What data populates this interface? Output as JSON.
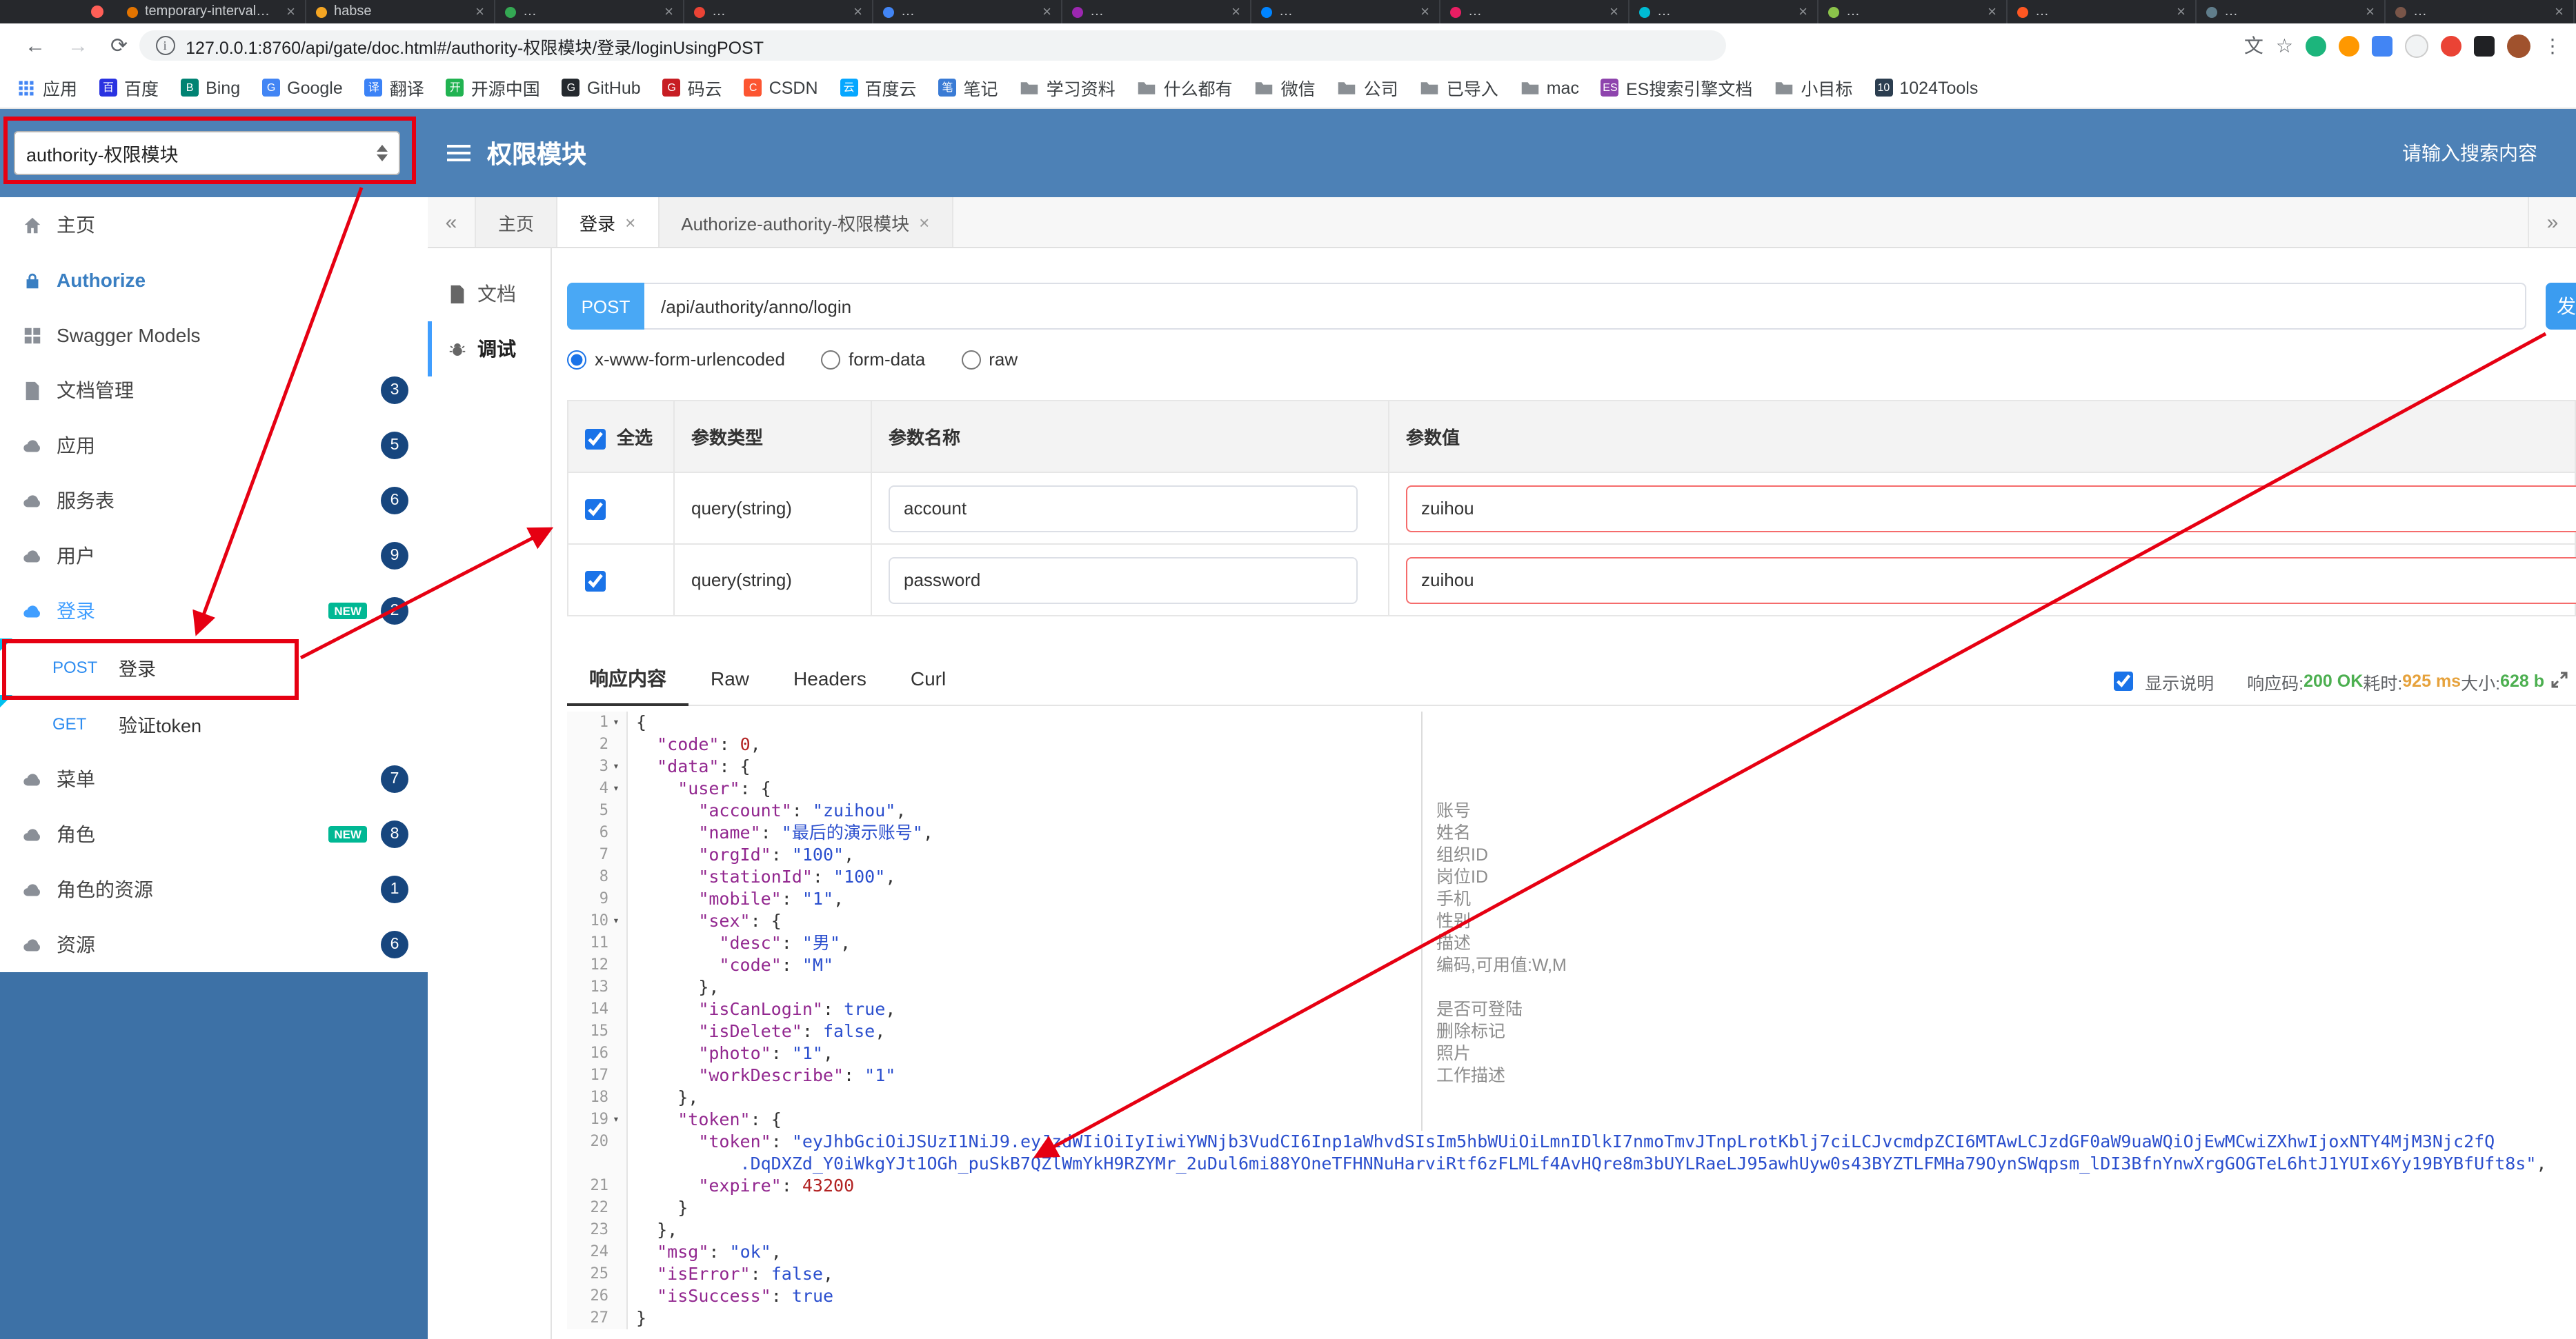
{
  "ui": {
    "close_glyph": "×",
    "fold_glyph": "▾",
    "info_glyph": "i"
  },
  "browser": {
    "tabs": [
      {
        "label": "temporary-interval…",
        "color": "#e37400"
      },
      {
        "label": "habse",
        "color": "#f5a623"
      },
      {
        "label": "…",
        "color": "#34a853"
      },
      {
        "label": "…",
        "color": "#ea4335"
      },
      {
        "label": "…",
        "color": "#4285f4"
      },
      {
        "label": "…",
        "color": "#9c27b0"
      },
      {
        "label": "…",
        "color": "#0084ff"
      },
      {
        "label": "…",
        "color": "#e91e63"
      },
      {
        "label": "…",
        "color": "#00bcd4"
      },
      {
        "label": "…",
        "color": "#8bc34a"
      },
      {
        "label": "…",
        "color": "#ff5722"
      },
      {
        "label": "…",
        "color": "#607d8b"
      },
      {
        "label": "…",
        "color": "#795548"
      },
      {
        "label": "…",
        "color": "#3f51b5"
      }
    ],
    "toolbar": {
      "url": "127.0.0.1:8760/api/gate/doc.html#/authority-权限模块/登录/loginUsingPOST",
      "icons": [
        "back",
        "forward",
        "reload",
        "info",
        "translate",
        "star",
        "ext-green",
        "ext-orange",
        "ext-blue",
        "ext-light",
        "ext-red",
        "ext-dark",
        "avatar",
        "menu"
      ]
    },
    "bookmarks": [
      {
        "label": "应用",
        "icon": "apps"
      },
      {
        "label": "百度",
        "icon": "letter",
        "letter": "百",
        "color": "#2932e1"
      },
      {
        "label": "Bing",
        "icon": "letter",
        "letter": "B",
        "color": "#008373"
      },
      {
        "label": "Google",
        "icon": "letter",
        "letter": "G",
        "color": "#4285f4"
      },
      {
        "label": "翻译",
        "icon": "letter",
        "letter": "译",
        "color": "#3b82f6"
      },
      {
        "label": "开源中国",
        "icon": "letter",
        "letter": "开",
        "color": "#21b351"
      },
      {
        "label": "GitHub",
        "icon": "letter",
        "letter": "G",
        "color": "#24292e"
      },
      {
        "label": "码云",
        "icon": "letter",
        "letter": "G",
        "color": "#c71d23"
      },
      {
        "label": "CSDN",
        "icon": "letter",
        "letter": "C",
        "color": "#fc5531"
      },
      {
        "label": "百度云",
        "icon": "letter",
        "letter": "云",
        "color": "#06a7ff"
      },
      {
        "label": "笔记",
        "icon": "letter",
        "letter": "笔",
        "color": "#3a7bd5"
      },
      {
        "label": "学习资料",
        "icon": "folder"
      },
      {
        "label": "什么都有",
        "icon": "folder"
      },
      {
        "label": "微信",
        "icon": "folder"
      },
      {
        "label": "公司",
        "icon": "folder"
      },
      {
        "label": "已导入",
        "icon": "folder"
      },
      {
        "label": "mac",
        "icon": "folder"
      },
      {
        "label": "ES搜索引擎文档",
        "icon": "letter",
        "letter": "ES",
        "color": "#8e44ad"
      },
      {
        "label": "小目标",
        "icon": "folder"
      },
      {
        "label": "1024Tools",
        "icon": "letter",
        "letter": "10",
        "color": "#2c3e50"
      }
    ]
  },
  "header": {
    "module_select": "authority-权限模块",
    "title": "权限模块",
    "search": "请输入搜索内容"
  },
  "sidebar": {
    "new_label": "NEW",
    "items": [
      {
        "id": "home",
        "icon": "home",
        "label": "主页"
      },
      {
        "id": "authorize",
        "icon": "lock",
        "label": "Authorize",
        "authorize": true
      },
      {
        "id": "models",
        "icon": "models",
        "label": "Swagger Models"
      },
      {
        "id": "docs",
        "icon": "doc",
        "label": "文档管理",
        "badge": "3"
      },
      {
        "id": "app",
        "icon": "cloud",
        "label": "应用",
        "badge": "5"
      },
      {
        "id": "service",
        "icon": "cloud",
        "label": "服务表",
        "badge": "6"
      },
      {
        "id": "user",
        "icon": "cloud",
        "label": "用户",
        "badge": "9"
      },
      {
        "id": "login",
        "icon": "cloud",
        "label": "登录",
        "badge": "2",
        "isNew": true,
        "active": true,
        "children": [
          {
            "method": "POST",
            "label": "登录",
            "highlight": true
          },
          {
            "method": "GET",
            "label": "验证token"
          }
        ]
      },
      {
        "id": "menu",
        "icon": "cloud",
        "label": "菜单",
        "badge": "7"
      },
      {
        "id": "role",
        "icon": "cloud",
        "label": "角色",
        "badge": "8",
        "isNew": true
      },
      {
        "id": "role-res",
        "icon": "cloud",
        "label": "角色的资源",
        "badge": "1"
      },
      {
        "id": "res",
        "icon": "cloud",
        "label": "资源",
        "badge": "6"
      }
    ]
  },
  "content_tabs": {
    "back": "«",
    "forward": "»",
    "items": [
      {
        "label": "主页",
        "closable": false
      },
      {
        "label": "登录",
        "closable": true,
        "active": true
      },
      {
        "label": "Authorize-authority-权限模块",
        "closable": true
      }
    ]
  },
  "doc_nav": {
    "items": [
      {
        "label": "文档",
        "icon": "doc"
      },
      {
        "label": "调试",
        "icon": "debug",
        "active": true
      }
    ]
  },
  "request": {
    "method": "POST",
    "path": "/api/authority/anno/login",
    "send": "发送",
    "content_types": [
      {
        "label": "x-www-form-urlencoded",
        "selected": true
      },
      {
        "label": "form-data",
        "selected": false
      },
      {
        "label": "raw",
        "selected": false
      }
    ]
  },
  "params": {
    "select_all": "全选",
    "headers": [
      "参数类型",
      "参数名称",
      "参数值"
    ],
    "rows": [
      {
        "checked": true,
        "type": "query(string)",
        "name": "account",
        "value": "zuihou"
      },
      {
        "checked": true,
        "type": "query(string)",
        "name": "password",
        "value": "zuihou"
      }
    ]
  },
  "response": {
    "tabs": [
      {
        "label": "响应内容",
        "active": true
      },
      {
        "label": "Raw",
        "active": false
      },
      {
        "label": "Headers",
        "active": false
      },
      {
        "label": "Curl",
        "active": false
      }
    ],
    "show_desc": "显示说明",
    "meta": [
      {
        "label": "响应码:",
        "value": "200 OK",
        "color": "#4caf50"
      },
      {
        "label": "耗时:",
        "value": "925 ms",
        "color": "#e6a23c"
      },
      {
        "label": "大小:",
        "value": "628 b",
        "color": "#4caf50"
      }
    ]
  },
  "code": {
    "lines": [
      {
        "n": 1,
        "indent": 0,
        "fold": true,
        "t": [
          [
            "p",
            "{"
          ]
        ]
      },
      {
        "n": 2,
        "indent": 1,
        "t": [
          [
            "k",
            "\"code\""
          ],
          [
            "p",
            ": "
          ],
          [
            "n",
            "0"
          ],
          [
            "p",
            ","
          ]
        ]
      },
      {
        "n": 3,
        "indent": 1,
        "fold": true,
        "t": [
          [
            "k",
            "\"data\""
          ],
          [
            "p",
            ": {"
          ]
        ]
      },
      {
        "n": 4,
        "indent": 2,
        "fold": true,
        "t": [
          [
            "k",
            "\"user\""
          ],
          [
            "p",
            ": {"
          ]
        ]
      },
      {
        "n": 5,
        "indent": 3,
        "desc": "账号",
        "t": [
          [
            "k",
            "\"account\""
          ],
          [
            "p",
            ": "
          ],
          [
            "s",
            "\"zuihou\""
          ],
          [
            "p",
            ","
          ]
        ]
      },
      {
        "n": 6,
        "indent": 3,
        "desc": "姓名",
        "t": [
          [
            "k",
            "\"name\""
          ],
          [
            "p",
            ": "
          ],
          [
            "s",
            "\"最后的演示账号\""
          ],
          [
            "p",
            ","
          ]
        ]
      },
      {
        "n": 7,
        "indent": 3,
        "desc": "组织ID",
        "t": [
          [
            "k",
            "\"orgId\""
          ],
          [
            "p",
            ": "
          ],
          [
            "s",
            "\"100\""
          ],
          [
            "p",
            ","
          ]
        ]
      },
      {
        "n": 8,
        "indent": 3,
        "desc": "岗位ID",
        "t": [
          [
            "k",
            "\"stationId\""
          ],
          [
            "p",
            ": "
          ],
          [
            "s",
            "\"100\""
          ],
          [
            "p",
            ","
          ]
        ]
      },
      {
        "n": 9,
        "indent": 3,
        "desc": "手机",
        "t": [
          [
            "k",
            "\"mobile\""
          ],
          [
            "p",
            ": "
          ],
          [
            "s",
            "\"1\""
          ],
          [
            "p",
            ","
          ]
        ]
      },
      {
        "n": 10,
        "indent": 3,
        "fold": true,
        "desc": "性别",
        "t": [
          [
            "k",
            "\"sex\""
          ],
          [
            "p",
            ": {"
          ]
        ]
      },
      {
        "n": 11,
        "indent": 4,
        "desc": "描述",
        "t": [
          [
            "k",
            "\"desc\""
          ],
          [
            "p",
            ": "
          ],
          [
            "s",
            "\"男\""
          ],
          [
            "p",
            ","
          ]
        ]
      },
      {
        "n": 12,
        "indent": 4,
        "desc": "编码,可用值:W,M",
        "t": [
          [
            "k",
            "\"code\""
          ],
          [
            "p",
            ": "
          ],
          [
            "s",
            "\"M\""
          ]
        ]
      },
      {
        "n": 13,
        "indent": 3,
        "t": [
          [
            "p",
            "},"
          ]
        ]
      },
      {
        "n": 14,
        "indent": 3,
        "desc": "是否可登陆",
        "t": [
          [
            "k",
            "\"isCanLogin\""
          ],
          [
            "p",
            ": "
          ],
          [
            "b",
            "true"
          ],
          [
            "p",
            ","
          ]
        ]
      },
      {
        "n": 15,
        "indent": 3,
        "desc": "删除标记",
        "t": [
          [
            "k",
            "\"isDelete\""
          ],
          [
            "p",
            ": "
          ],
          [
            "b",
            "false"
          ],
          [
            "p",
            ","
          ]
        ]
      },
      {
        "n": 16,
        "indent": 3,
        "desc": "照片",
        "t": [
          [
            "k",
            "\"photo\""
          ],
          [
            "p",
            ": "
          ],
          [
            "s",
            "\"1\""
          ],
          [
            "p",
            ","
          ]
        ]
      },
      {
        "n": 17,
        "indent": 3,
        "desc": "工作描述",
        "t": [
          [
            "k",
            "\"workDescribe\""
          ],
          [
            "p",
            ": "
          ],
          [
            "s",
            "\"1\""
          ]
        ]
      },
      {
        "n": 18,
        "indent": 2,
        "t": [
          [
            "p",
            "},"
          ]
        ]
      },
      {
        "n": 19,
        "indent": 2,
        "fold": true,
        "t": [
          [
            "k",
            "\"token\""
          ],
          [
            "p",
            ": {"
          ]
        ]
      },
      {
        "n": 20,
        "indent": 3,
        "t": [
          [
            "k",
            "\"token\""
          ],
          [
            "p",
            ": "
          ],
          [
            "s",
            "\"eyJhbGciOiJSUzI1NiJ9.eyJzdWIiOiIyIiwiYWNjb3VudCI6Inp1aWhvdSIsIm5hbWUiOiLmnIDlkI7nmoTmvJTnpLrotKblj7ciLCJvcmdpZCI6MTAwLCJzdGF0aW9uaWQiOjEwMCwiZXhwIjoxNTY4MjM3Njc2fQ"
          ],
          [
            "br",
            "          "
          ],
          [
            "s",
            ".DqDXZd_Y0iWkgYJt1OGh_puSkB7QZlWmYkH9RZYMr_2uDul6mi88YOneTFHNNuHarviRtf6zFLMLf4AvHQre8m3bUYLRaeLJ95awhUyw0s43BYZTLFMHa79OynSWqpsm_lDI3BfnYnwXrgGOGTeL6htJ1YUIx6Yy19BYBfUft8s\""
          ],
          [
            "p",
            ","
          ]
        ]
      },
      {
        "n": 21,
        "indent": 3,
        "t": [
          [
            "k",
            "\"expire\""
          ],
          [
            "p",
            ": "
          ],
          [
            "n",
            "43200"
          ]
        ]
      },
      {
        "n": 22,
        "indent": 2,
        "t": [
          [
            "p",
            "}"
          ]
        ]
      },
      {
        "n": 23,
        "indent": 1,
        "t": [
          [
            "p",
            "},"
          ]
        ]
      },
      {
        "n": 24,
        "indent": 1,
        "t": [
          [
            "k",
            "\"msg\""
          ],
          [
            "p",
            ": "
          ],
          [
            "s",
            "\"ok\""
          ],
          [
            "p",
            ","
          ]
        ]
      },
      {
        "n": 25,
        "indent": 1,
        "t": [
          [
            "k",
            "\"isError\""
          ],
          [
            "p",
            ": "
          ],
          [
            "b",
            "false"
          ],
          [
            "p",
            ","
          ]
        ]
      },
      {
        "n": 26,
        "indent": 1,
        "t": [
          [
            "k",
            "\"isSuccess\""
          ],
          [
            "p",
            ": "
          ],
          [
            "b",
            "true"
          ]
        ]
      },
      {
        "n": 27,
        "indent": 0,
        "t": [
          [
            "p",
            "}"
          ]
        ]
      }
    ]
  }
}
